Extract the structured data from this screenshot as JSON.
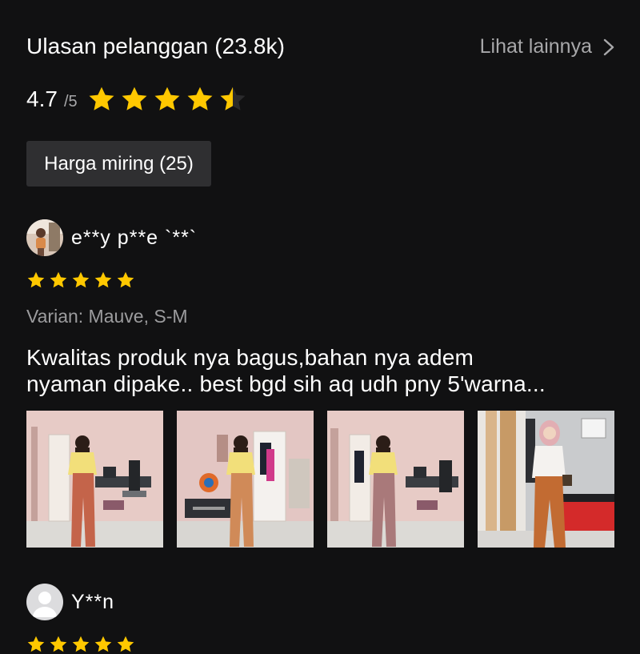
{
  "header": {
    "title": "Ulasan pelanggan (23.8k)",
    "see_more_label": "Lihat lainnya",
    "see_more_icon": "chevron-right-icon"
  },
  "rating": {
    "value": "4.7",
    "max": "/5",
    "stars": 4.7,
    "star_color": "#ffc800"
  },
  "filters": [
    {
      "label": "Harga miring (25)"
    }
  ],
  "reviews": [
    {
      "reviewer": "e**y p**e `**`",
      "stars": 5,
      "variant": "Varian: Mauve, S-M",
      "text_line1": "Kwalitas produk nya bagus,bahan nya adem",
      "text_line2": "nyaman dipake.. best bgd sih aq udh pny 5'warna...",
      "photo_count": 4
    },
    {
      "reviewer": "Y**n",
      "stars": 5
    }
  ]
}
